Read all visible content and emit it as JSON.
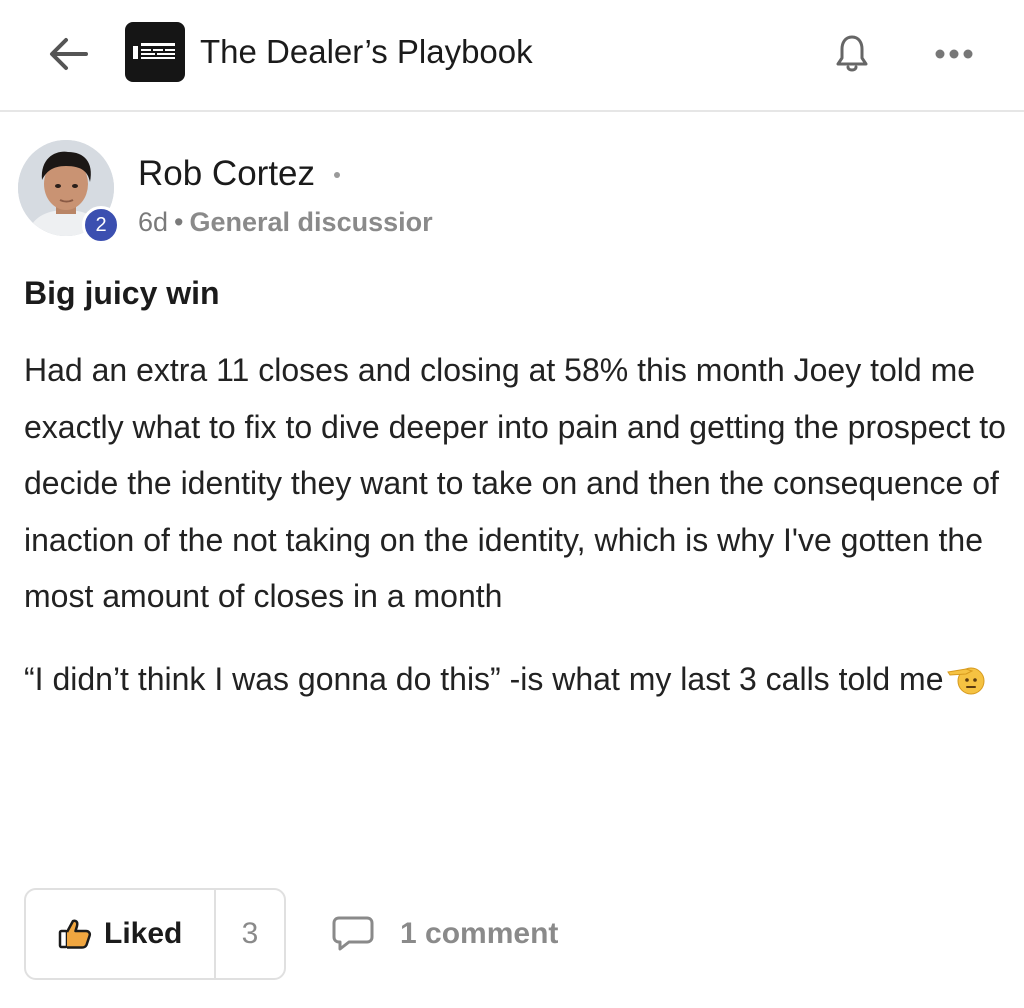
{
  "header": {
    "title": "The Dealer’s Playbook",
    "back_icon": "arrow-left-icon",
    "notification_icon": "bell-icon",
    "more_icon": "more-horizontal-icon"
  },
  "post": {
    "author": {
      "name": "Rob Cortez",
      "level": "2",
      "badge_color": "#3b4fb0"
    },
    "age": "6d",
    "separator": "•",
    "category": "General discussior",
    "title": "Big juicy win",
    "body": [
      "Had an extra 11 closes and closing at 58% this month Joey told me exactly what to fix to dive deeper into pain and getting the prospect to decide the identity they want to take on and then the consequence of inaction of the not taking on the identity, which is why I've gotten the most amount of closes in a month",
      "“I didn’t think I was gonna do this” -is what my last 3 calls told me"
    ],
    "emoji": "saluting-face-emoji"
  },
  "actions": {
    "like_label": "Liked",
    "like_count": "3",
    "like_icon": "thumbs-up-icon",
    "comment_label": "1 comment",
    "comment_icon": "comment-bubble-icon"
  }
}
